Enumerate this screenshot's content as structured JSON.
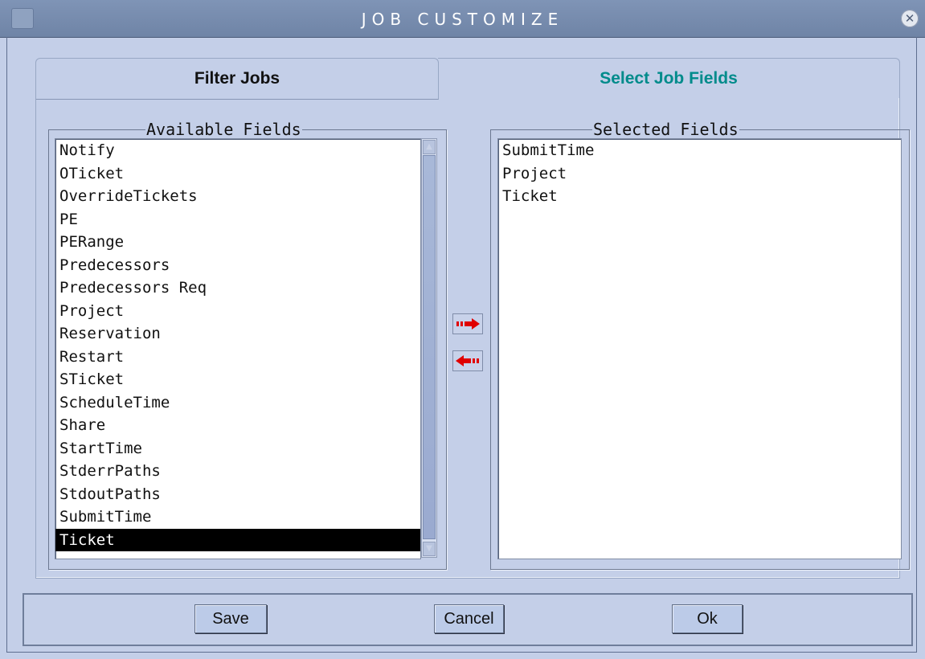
{
  "window": {
    "title": "JOB CUSTOMIZE"
  },
  "tabs": [
    {
      "label": "Filter Jobs",
      "active": false
    },
    {
      "label": "Select Job Fields",
      "active": true,
      "color": "#008b8b"
    }
  ],
  "available_fields": {
    "legend": "Available Fields",
    "items": [
      "Notify",
      "OTicket",
      "OverrideTickets",
      "PE",
      "PERange",
      "Predecessors",
      "Predecessors Req",
      "Project",
      "Reservation",
      "Restart",
      "STicket",
      "ScheduleTime",
      "Share",
      "StartTime",
      "StderrPaths",
      "StdoutPaths",
      "SubmitTime",
      "Ticket"
    ],
    "selected_item": "Ticket"
  },
  "selected_fields": {
    "legend": "Selected Fields",
    "items": [
      "SubmitTime",
      "Project",
      "Ticket"
    ]
  },
  "transfer": {
    "add_icon": "arrow-right-icon",
    "remove_icon": "arrow-left-icon",
    "arrow_color": "#e00000"
  },
  "footer": {
    "save_label": "Save",
    "cancel_label": "Cancel",
    "ok_label": "Ok"
  }
}
